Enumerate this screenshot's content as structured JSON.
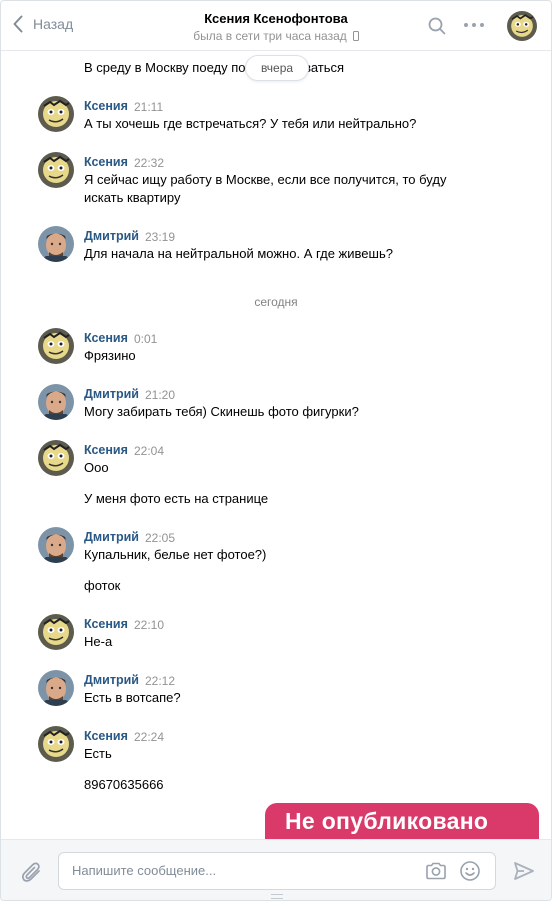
{
  "header": {
    "back_label": "Назад",
    "peer_name": "Ксения Ксенофонтова",
    "peer_status": "была в сети три часа назад"
  },
  "floating_date": "вчера",
  "messages": [
    {
      "text": "В среду в Москву поеду по договариваться"
    },
    {
      "author": "Ксения",
      "time": "21:11",
      "text": "А ты хочешь где встречаться? У тебя или нейтрально?"
    },
    {
      "author": "Ксения",
      "time": "22:32",
      "text": "Я сейчас ищу работу в Москве, если все получится, то буду искать квартиру"
    },
    {
      "author": "Дмитрий",
      "time": "23:19",
      "text": "Для начала на нейтральной можно. А где живешь?"
    },
    {
      "author": "Ксения",
      "time": "0:01",
      "text": "Фрязино"
    },
    {
      "author": "Дмитрий",
      "time": "21:20",
      "text": "Могу забирать тебя) Скинешь фото фигурки?"
    },
    {
      "author": "Ксения",
      "time": "22:04",
      "text": "Ооо",
      "text2": "У меня фото есть на странице"
    },
    {
      "author": "Дмитрий",
      "time": "22:05",
      "text": "Купальник, белье нет фотое?)",
      "text2": "фоток"
    },
    {
      "author": "Ксения",
      "time": "22:10",
      "text": "Не-а"
    },
    {
      "author": "Дмитрий",
      "time": "22:12",
      "text": "Есть в вотсапе?"
    },
    {
      "author": "Ксения",
      "time": "22:24",
      "text": "Есть",
      "text2": "89670635666"
    }
  ],
  "date_separator": "сегодня",
  "banner": "Не опубликовано",
  "composer": {
    "placeholder": "Напишите сообщение..."
  },
  "colors": {
    "author": "#2a5885",
    "banner": "#d93a6a",
    "muted": "#939393"
  }
}
